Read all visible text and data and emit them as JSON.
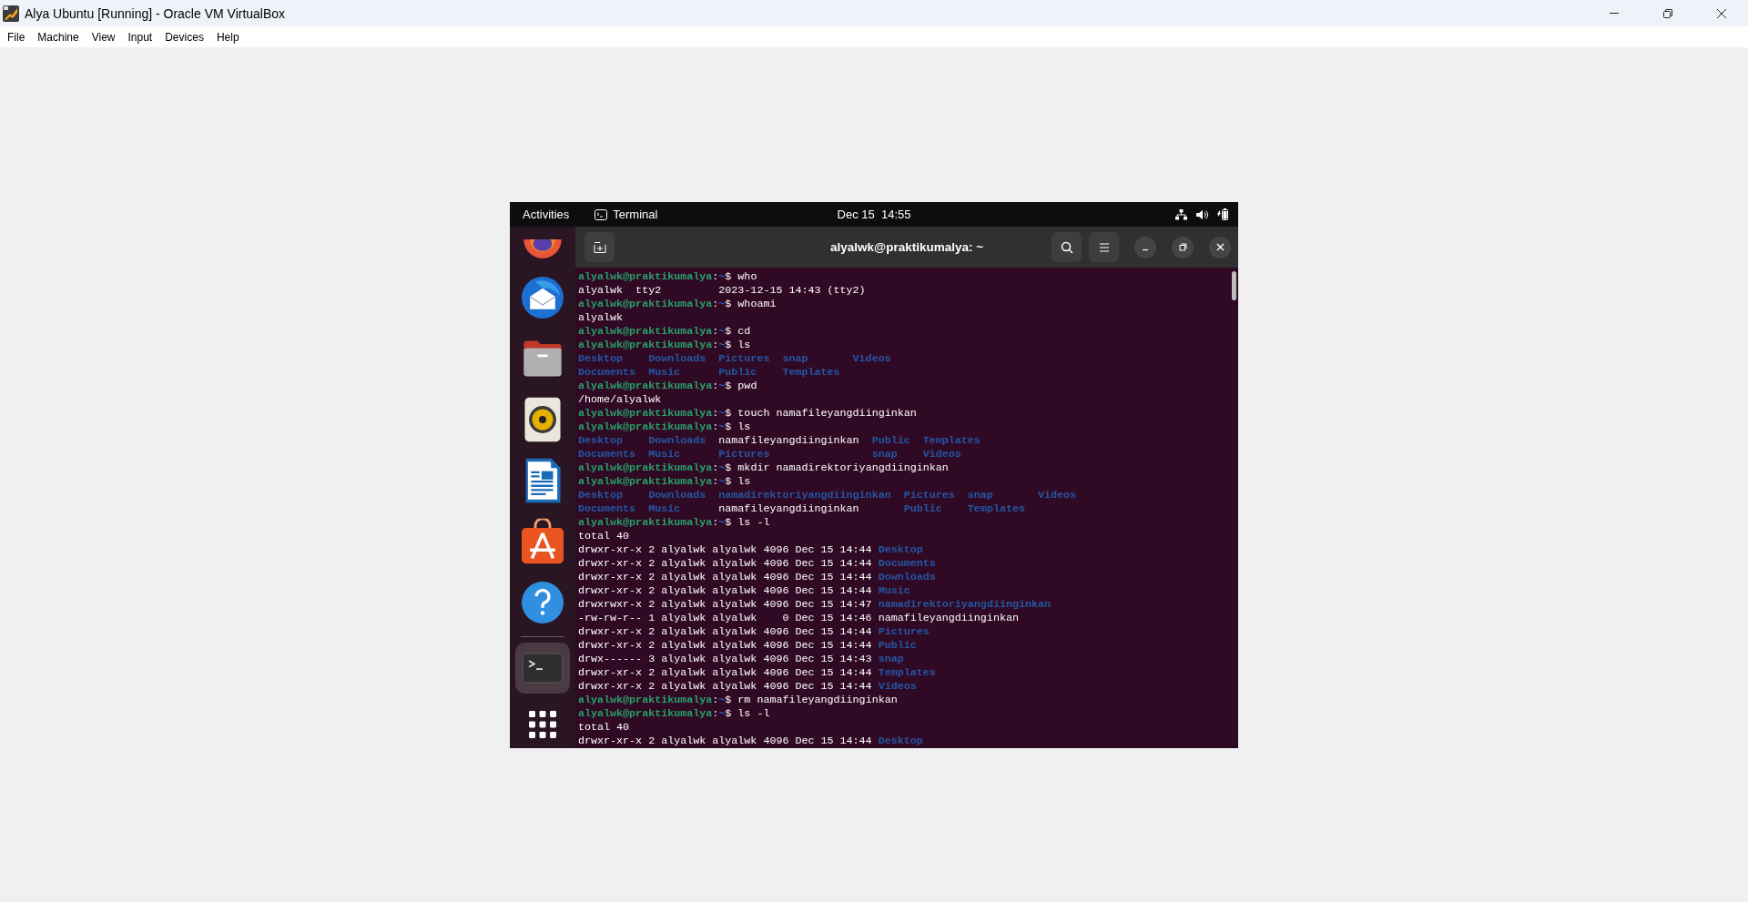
{
  "window": {
    "title": "Alya Ubuntu [Running] - Oracle VM VirtualBox"
  },
  "menu": [
    "File",
    "Machine",
    "View",
    "Input",
    "Devices",
    "Help"
  ],
  "topbar": {
    "activities": "Activities",
    "app": "Terminal",
    "clock": "Dec 15  14:55"
  },
  "dock_items": [
    {
      "selected": false
    },
    {
      "selected": false
    },
    {
      "selected": false
    },
    {
      "selected": false
    },
    {
      "selected": false
    },
    {
      "selected": false
    },
    {
      "selected": false
    },
    {
      "selected": true
    },
    {
      "selected": false
    }
  ],
  "terminal": {
    "title": "alyalwk@praktikumalya: ~",
    "lines": [
      {
        "kind": "prompt",
        "user": "alyalwk@praktikumalya",
        "colon": ":",
        "path": "~",
        "command": "$ who"
      },
      {
        "kind": "output",
        "segments": [
          {
            "kind": "plain",
            "text": "alyalwk  tty2         2023-12-15 14:43 (tty2)"
          }
        ]
      },
      {
        "kind": "prompt",
        "user": "alyalwk@praktikumalya",
        "colon": ":",
        "path": "~",
        "command": "$ whoami"
      },
      {
        "kind": "output",
        "segments": [
          {
            "kind": "plain",
            "text": "alyalwk"
          }
        ]
      },
      {
        "kind": "prompt",
        "user": "alyalwk@praktikumalya",
        "colon": ":",
        "path": "~",
        "command": "$ cd"
      },
      {
        "kind": "prompt",
        "user": "alyalwk@praktikumalya",
        "colon": ":",
        "path": "~",
        "command": "$ ls"
      },
      {
        "kind": "output",
        "segments": [
          {
            "kind": "dir",
            "text": "Desktop    Downloads  Pictures  snap       Videos"
          }
        ]
      },
      {
        "kind": "output",
        "segments": [
          {
            "kind": "dir",
            "text": "Documents  Music      Public    Templates"
          }
        ]
      },
      {
        "kind": "prompt",
        "user": "alyalwk@praktikumalya",
        "colon": ":",
        "path": "~",
        "command": "$ pwd"
      },
      {
        "kind": "output",
        "segments": [
          {
            "kind": "plain",
            "text": "/home/alyalwk"
          }
        ]
      },
      {
        "kind": "prompt",
        "user": "alyalwk@praktikumalya",
        "colon": ":",
        "path": "~",
        "command": "$ touch namafileyangdiinginkan"
      },
      {
        "kind": "prompt",
        "user": "alyalwk@praktikumalya",
        "colon": ":",
        "path": "~",
        "command": "$ ls"
      },
      {
        "kind": "output",
        "segments": [
          {
            "kind": "dir",
            "text": "Desktop    Downloads  "
          },
          {
            "kind": "plain",
            "text": "namafileyangdiinginkan  "
          },
          {
            "kind": "dir",
            "text": "Public  Templates"
          }
        ]
      },
      {
        "kind": "output",
        "segments": [
          {
            "kind": "dir",
            "text": "Documents  Music      Pictures                snap    Videos"
          }
        ]
      },
      {
        "kind": "prompt",
        "user": "alyalwk@praktikumalya",
        "colon": ":",
        "path": "~",
        "command": "$ mkdir namadirektoriyangdiinginkan"
      },
      {
        "kind": "prompt",
        "user": "alyalwk@praktikumalya",
        "colon": ":",
        "path": "~",
        "command": "$ ls"
      },
      {
        "kind": "output",
        "segments": [
          {
            "kind": "dir",
            "text": "Desktop    Downloads  namadirektoriyangdiinginkan  Pictures  snap       Videos"
          }
        ]
      },
      {
        "kind": "output",
        "segments": [
          {
            "kind": "dir",
            "text": "Documents  Music      "
          },
          {
            "kind": "plain",
            "text": "namafileyangdiinginkan       "
          },
          {
            "kind": "dir",
            "text": "Public    Templates"
          }
        ]
      },
      {
        "kind": "prompt",
        "user": "alyalwk@praktikumalya",
        "colon": ":",
        "path": "~",
        "command": "$ ls -l"
      },
      {
        "kind": "output",
        "segments": [
          {
            "kind": "plain",
            "text": "total 40"
          }
        ]
      },
      {
        "kind": "output",
        "segments": [
          {
            "kind": "plain",
            "text": "drwxr-xr-x 2 alyalwk alyalwk 4096 Dec 15 14:44 "
          },
          {
            "kind": "dir",
            "text": "Desktop"
          }
        ]
      },
      {
        "kind": "output",
        "segments": [
          {
            "kind": "plain",
            "text": "drwxr-xr-x 2 alyalwk alyalwk 4096 Dec 15 14:44 "
          },
          {
            "kind": "dir",
            "text": "Documents"
          }
        ]
      },
      {
        "kind": "output",
        "segments": [
          {
            "kind": "plain",
            "text": "drwxr-xr-x 2 alyalwk alyalwk 4096 Dec 15 14:44 "
          },
          {
            "kind": "dir",
            "text": "Downloads"
          }
        ]
      },
      {
        "kind": "output",
        "segments": [
          {
            "kind": "plain",
            "text": "drwxr-xr-x 2 alyalwk alyalwk 4096 Dec 15 14:44 "
          },
          {
            "kind": "dir",
            "text": "Music"
          }
        ]
      },
      {
        "kind": "output",
        "segments": [
          {
            "kind": "plain",
            "text": "drwxrwxr-x 2 alyalwk alyalwk 4096 Dec 15 14:47 "
          },
          {
            "kind": "dir",
            "text": "namadirektoriyangdiinginkan"
          }
        ]
      },
      {
        "kind": "output",
        "segments": [
          {
            "kind": "plain",
            "text": "-rw-rw-r-- 1 alyalwk alyalwk    0 Dec 15 14:46 namafileyangdiinginkan"
          }
        ]
      },
      {
        "kind": "output",
        "segments": [
          {
            "kind": "plain",
            "text": "drwxr-xr-x 2 alyalwk alyalwk 4096 Dec 15 14:44 "
          },
          {
            "kind": "dir",
            "text": "Pictures"
          }
        ]
      },
      {
        "kind": "output",
        "segments": [
          {
            "kind": "plain",
            "text": "drwxr-xr-x 2 alyalwk alyalwk 4096 Dec 15 14:44 "
          },
          {
            "kind": "dir",
            "text": "Public"
          }
        ]
      },
      {
        "kind": "output",
        "segments": [
          {
            "kind": "plain",
            "text": "drwx------ 3 alyalwk alyalwk 4096 Dec 15 14:43 "
          },
          {
            "kind": "dir",
            "text": "snap"
          }
        ]
      },
      {
        "kind": "output",
        "segments": [
          {
            "kind": "plain",
            "text": "drwxr-xr-x 2 alyalwk alyalwk 4096 Dec 15 14:44 "
          },
          {
            "kind": "dir",
            "text": "Templates"
          }
        ]
      },
      {
        "kind": "output",
        "segments": [
          {
            "kind": "plain",
            "text": "drwxr-xr-x 2 alyalwk alyalwk 4096 Dec 15 14:44 "
          },
          {
            "kind": "dir",
            "text": "Videos"
          }
        ]
      },
      {
        "kind": "prompt",
        "user": "alyalwk@praktikumalya",
        "colon": ":",
        "path": "~",
        "command": "$ rm namafileyangdiinginkan"
      },
      {
        "kind": "prompt",
        "user": "alyalwk@praktikumalya",
        "colon": ":",
        "path": "~",
        "command": "$ ls -l"
      },
      {
        "kind": "output",
        "segments": [
          {
            "kind": "plain",
            "text": "total 40"
          }
        ]
      },
      {
        "kind": "output",
        "segments": [
          {
            "kind": "plain",
            "text": "drwxr-xr-x 2 alyalwk alyalwk 4096 Dec 15 14:44 "
          },
          {
            "kind": "dir",
            "text": "Desktop"
          }
        ]
      }
    ]
  }
}
